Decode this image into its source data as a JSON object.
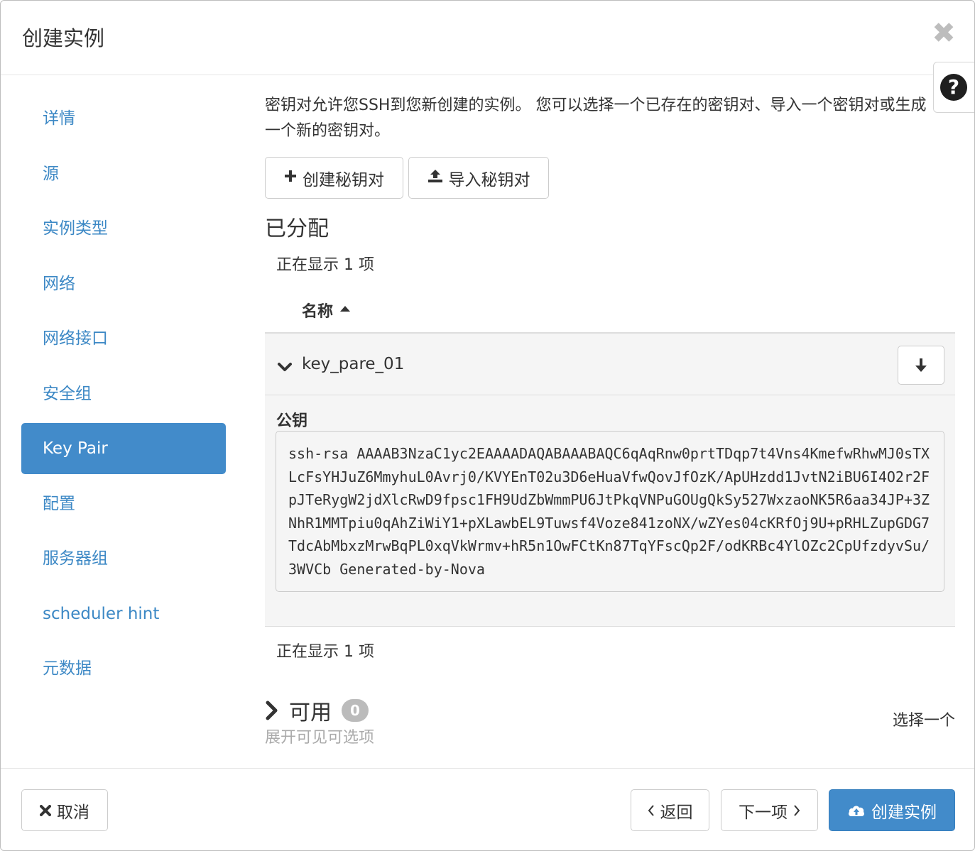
{
  "header": {
    "title": "创建实例",
    "close_glyph": "✖",
    "help_glyph": "?"
  },
  "sidebar": {
    "items": [
      {
        "label": "详情"
      },
      {
        "label": "源"
      },
      {
        "label": "实例类型"
      },
      {
        "label": "网络"
      },
      {
        "label": "网络接口"
      },
      {
        "label": "安全组"
      },
      {
        "label": "Key Pair",
        "active": true
      },
      {
        "label": "配置"
      },
      {
        "label": "服务器组"
      },
      {
        "label": "scheduler hint"
      },
      {
        "label": "元数据"
      }
    ]
  },
  "content": {
    "help_text": "密钥对允许您SSH到您新创建的实例。 您可以选择一个已存在的密钥对、导入一个密钥对或生成一个新的密钥对。",
    "create_keypair_label": "创建秘钥对",
    "import_keypair_label": "导入秘钥对",
    "allocated": {
      "title": "已分配",
      "count_text_top": "正在显示 1 项",
      "count_text_bottom": "正在显示 1 项",
      "column_name": "名称",
      "rows": [
        {
          "name": "key_pare_01",
          "public_key_label": "公钥",
          "public_key": "ssh-rsa AAAAB3NzaC1yc2EAAAADAQABAAABAQC6qAqRnw0prtTDqp7t4Vns4KmefwRhwMJ0sTXLcFsYHJuZ6MmyhuL0Avrj0/KVYEnT02u3D6eHuaVfwQovJfOzK/ApUHzdd1JvtN2iBU6I4O2r2FpJTeRygW2jdXlcRwD9fpsc1FH9UdZbWmmPU6JtPkqVNPuGOUgQkSy527WxzaoNK5R6aa34JP+3ZNhR1MMTpiu0qAhZiWiY1+pXLawbEL9Tuwsf4Voze841zoNX/wZYes04cKRfOj9U+pRHLZupGDG7TdcAbMbxzMrwBqPL0xqVkWrmv+hR5n1OwFCtKn87TqYFscQp2F/odKRBc4YlOZc2CpUfzdyvSu/3WVCb Generated-by-Nova"
        }
      ]
    },
    "available": {
      "title": "可用",
      "count": "0",
      "subtitle": "展开可见可选项",
      "select_one": "选择一个"
    }
  },
  "footer": {
    "cancel_label": "取消",
    "back_label": "返回",
    "next_label": "下一项",
    "launch_label": "创建实例"
  },
  "colors": {
    "primary": "#428bca",
    "link": "#3c88c5",
    "badge": "#bbbbbb"
  }
}
